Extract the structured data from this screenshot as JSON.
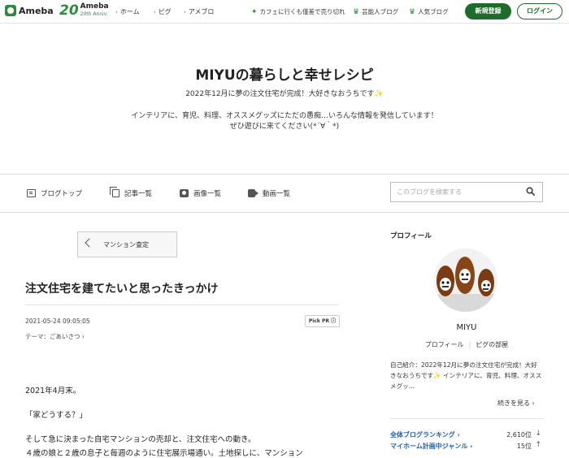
{
  "topbar": {
    "logo": "Ameba",
    "anniv_num": "20",
    "anniv_brand": "Ameba",
    "anniv_sub": "20th Anniv.",
    "nav": [
      "ホーム",
      "ピグ",
      "アメブロ"
    ],
    "links": [
      {
        "icon": "sparkle-icon",
        "label": "カフェに行くも僅差で売り切れ"
      },
      {
        "icon": "crown-icon",
        "label": "芸能人ブログ"
      },
      {
        "icon": "crown-icon",
        "label": "人気ブログ"
      }
    ],
    "register": "新規登録",
    "login": "ログイン",
    "accent": "#2d8c3c"
  },
  "blog": {
    "title": "MIYUの暮らしと幸せレシピ",
    "subtitle": "2022年12月に夢の注文住宅が完成！大好きなおうちです✨",
    "desc1": "インテリアに、育児、料理、オススメグッズにただの愚痴…いろんな情報を発信しています！",
    "desc2": "ぜひ遊びに来てください(*´∀｀*)"
  },
  "subnav": {
    "items": [
      "ブログトップ",
      "記事一覧",
      "画像一覧",
      "動画一覧"
    ],
    "search_placeholder": "このブログを検索する"
  },
  "article": {
    "prev_label": "マンション査定",
    "title": "注文住宅を建てたいと思ったきっかけ",
    "date": "2021-05-24 09:05:05",
    "pickpr": "Pick PR ⓘ",
    "theme": "テーマ：ごあいさつ",
    "lines": [
      "2021年4月末。",
      "「家どうする？」",
      "そして急に決まった自宅マンションの売却と、注文住宅への動き。",
      "４歳の娘と２歳の息子と毎週のように住宅展示場通い。土地探しに、マンション"
    ]
  },
  "sidebar": {
    "heading": "プロフィール",
    "name": "MIYU",
    "links": [
      "プロフィール",
      "ピグの部屋"
    ],
    "intro": "自己紹介：2022年12月に夢の注文住宅が完成！大好きなおうちです✨ インテリアに、育児、料理、オススメグッ...",
    "more": "続きを見る",
    "rankings": [
      {
        "label": "全体ブログランキング",
        "value": "2,610位",
        "trend": "↓"
      },
      {
        "label": "マイホーム計画中ジャンル",
        "value": "15位",
        "trend": "↑"
      }
    ]
  }
}
